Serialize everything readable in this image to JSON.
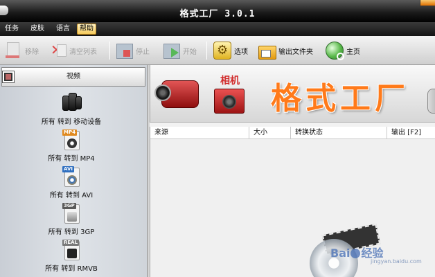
{
  "window": {
    "title": "格式工厂 3.0.1"
  },
  "menu": {
    "items": [
      "任务",
      "皮肤",
      "语言",
      "帮助"
    ],
    "active": "帮助"
  },
  "toolbar": {
    "remove": "移除",
    "clear_list": "清空列表",
    "stop": "停止",
    "start": "开始",
    "options": "选项",
    "output_folder": "输出文件夹",
    "home": "主页"
  },
  "left_panel": {
    "category": "视频",
    "items": [
      {
        "label": "所有 转到 移动设备",
        "icon": "mobile-devices-icon",
        "tag": ""
      },
      {
        "label": "所有 转到 MP4",
        "icon": "mp4-file-icon",
        "tag": "MP4",
        "tag_color": "#e08a20"
      },
      {
        "label": "所有 转到 AVI",
        "icon": "avi-file-icon",
        "tag": "AVI",
        "tag_color": "#2f6fc0"
      },
      {
        "label": "所有 转到 3GP",
        "icon": "3gp-file-icon",
        "tag": "3GP",
        "tag_color": "#5a5a5a"
      },
      {
        "label": "所有 转到 RMVB",
        "icon": "rmvb-file-icon",
        "tag": "REAL",
        "tag_color": "#7a7a7a"
      }
    ]
  },
  "banner": {
    "camera_label": "相机",
    "brand": "格式工厂"
  },
  "table": {
    "columns": [
      "来源",
      "大小",
      "转换状态",
      "输出 [F2]"
    ]
  },
  "watermark": {
    "text_left": "Bai",
    "text_right": "经验",
    "url": "jingyan.baidu.com"
  },
  "colors": {
    "brand_orange": "#ff7a1a",
    "camera_red": "#d12b2b",
    "menu_highlight": "#f5c95a"
  }
}
